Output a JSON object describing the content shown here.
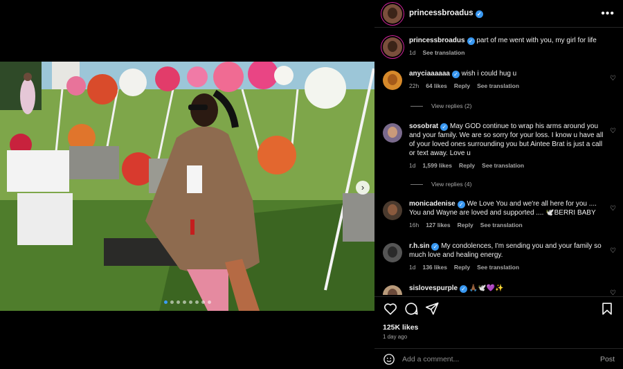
{
  "post": {
    "username": "princessbroadus",
    "more_icon": "more-horizontal-icon",
    "likes": "125K likes",
    "time_ago": "1 day ago",
    "carousel_dots": 8,
    "active_dot": 0
  },
  "caption": {
    "username": "princessbroadus",
    "text": "part of me went with you, my girl for life",
    "time": "1d",
    "see_translation": "See translation"
  },
  "comments": [
    {
      "username": "anyciaaaaaa",
      "verified": true,
      "text": "wish i could hug u",
      "time": "22h",
      "likes": "64 likes",
      "reply": "Reply",
      "see_translation": "See translation",
      "view_replies": "View replies (2)",
      "avatar_color": "#d6892a"
    },
    {
      "username": "sosobrat",
      "verified": true,
      "text": "May GOD continue to wrap his arms around you and your family. We are so sorry for your loss. I know u have all of your loved ones surrounding you but Aintee Brat is just a call or text away. Love u",
      "time": "1d",
      "likes": "1,599 likes",
      "reply": "Reply",
      "see_translation": "See translation",
      "view_replies": "View replies (4)",
      "avatar_color": "#7a6a8c"
    },
    {
      "username": "monicadenise",
      "verified": true,
      "text": "We Love You and we're all here for you .... You and Wayne are loved and supported .... 🕊️BERRI BABY",
      "time": "16h",
      "likes": "127 likes",
      "reply": "Reply",
      "see_translation": "See translation",
      "avatar_color": "#4a3a2e"
    },
    {
      "username": "r.h.sin",
      "verified": true,
      "text": "My condolences, I'm sending you and your family so much love and healing energy.",
      "time": "1d",
      "likes": "136 likes",
      "reply": "Reply",
      "see_translation": "See translation",
      "avatar_color": "#555555"
    },
    {
      "username": "sislovespurple",
      "verified": true,
      "text": "🙏🏾🕊️💜✨",
      "avatar_color": "#b89a7a"
    }
  ],
  "add_comment": {
    "placeholder": "Add a comment...",
    "post_label": "Post"
  },
  "colors": {
    "verified": "#3897f0",
    "ring": "#d6249f",
    "background": "#000000",
    "muted": "#a8a8a8"
  }
}
